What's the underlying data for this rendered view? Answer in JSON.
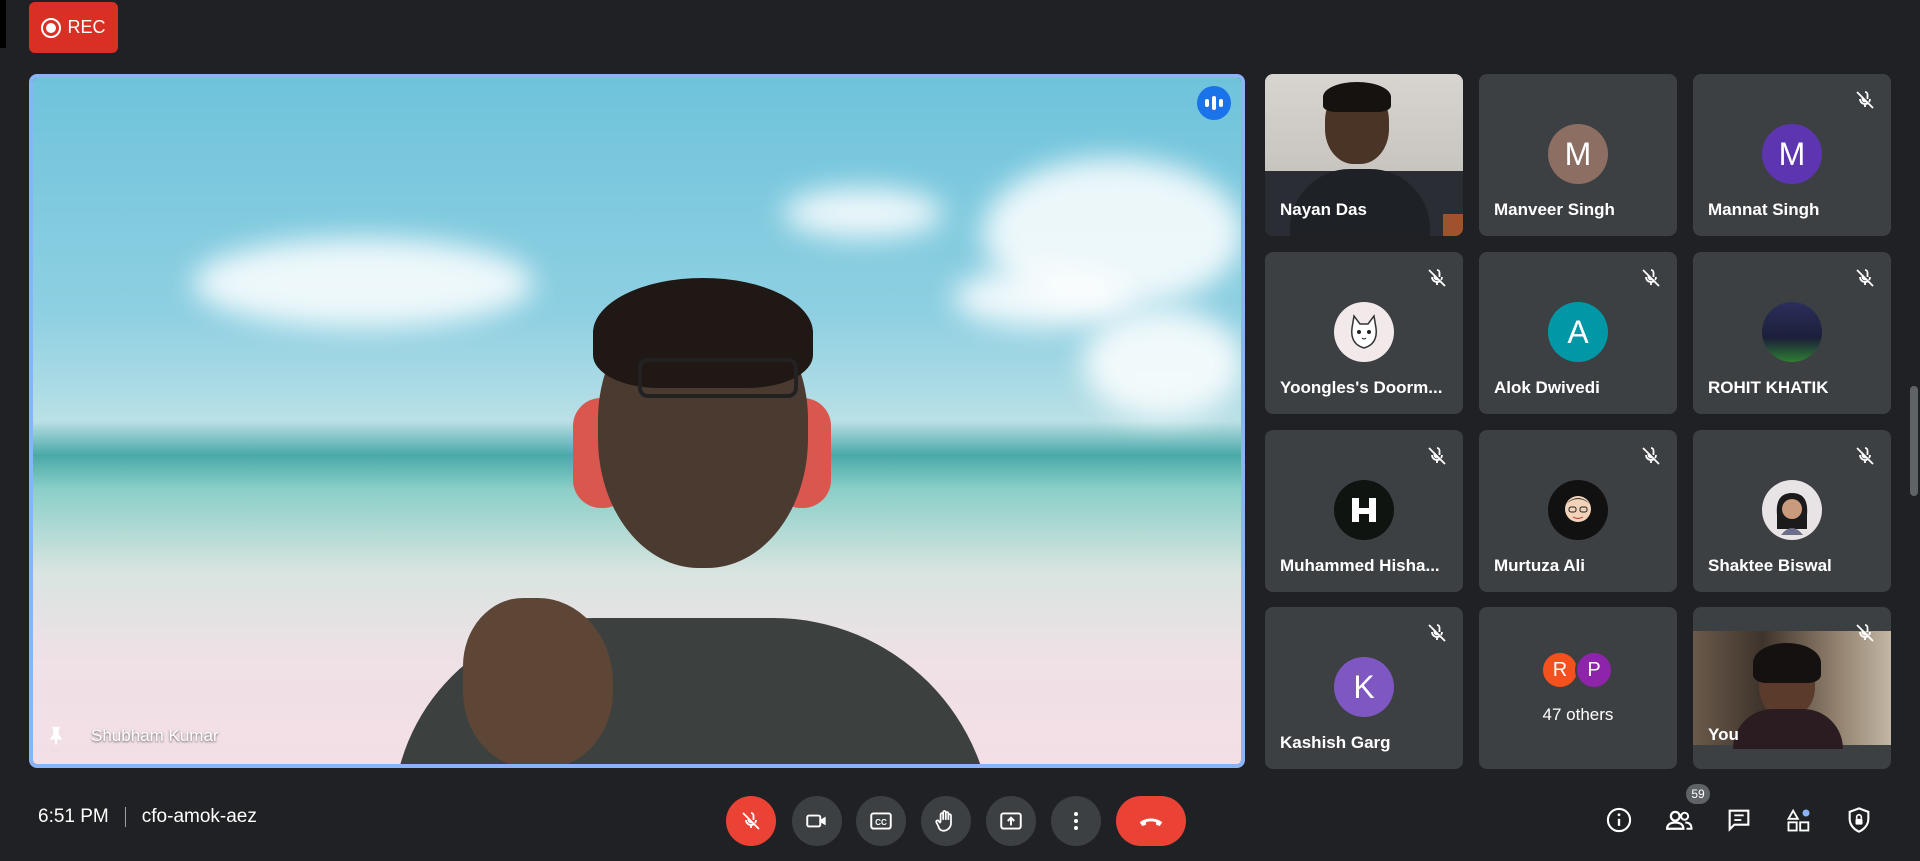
{
  "recording": {
    "label": "REC"
  },
  "main_speaker": {
    "name": "Shubham Kumar"
  },
  "participants": [
    {
      "name": "Nayan Das",
      "type": "video"
    },
    {
      "name": "Manveer Singh",
      "initial": "M",
      "avatar_color": "#8d6e63",
      "muted": false
    },
    {
      "name": "Mannat Singh",
      "initial": "M",
      "avatar_color": "#5e35b1",
      "muted": true
    },
    {
      "name": "Yoongles's Doorm...",
      "type": "image",
      "muted": true
    },
    {
      "name": "Alok Dwivedi",
      "initial": "A",
      "avatar_color": "#0097a7",
      "muted": true
    },
    {
      "name": "ROHIT KHATIK",
      "type": "image",
      "muted": true
    },
    {
      "name": "Muhammed Hisha...",
      "type": "image",
      "muted": true
    },
    {
      "name": "Murtuza Ali",
      "type": "image",
      "muted": true
    },
    {
      "name": "Shaktee Biswal",
      "type": "image",
      "muted": true
    },
    {
      "name": "Kashish Garg",
      "initial": "K",
      "avatar_color": "#7e57c2",
      "muted": true
    },
    {
      "name": "47 others",
      "others": [
        "R",
        "P"
      ],
      "other_colors": [
        "#f4511e",
        "#8e24aa"
      ]
    },
    {
      "name": "You",
      "type": "video",
      "muted": true
    }
  ],
  "footer": {
    "time": "6:51 PM",
    "meeting_code": "cfo-amok-aez",
    "people_count": "59"
  },
  "colors": {
    "accent": "#8ab4f8",
    "danger": "#ea4335",
    "tile": "#3c4043",
    "background": "#202124"
  }
}
